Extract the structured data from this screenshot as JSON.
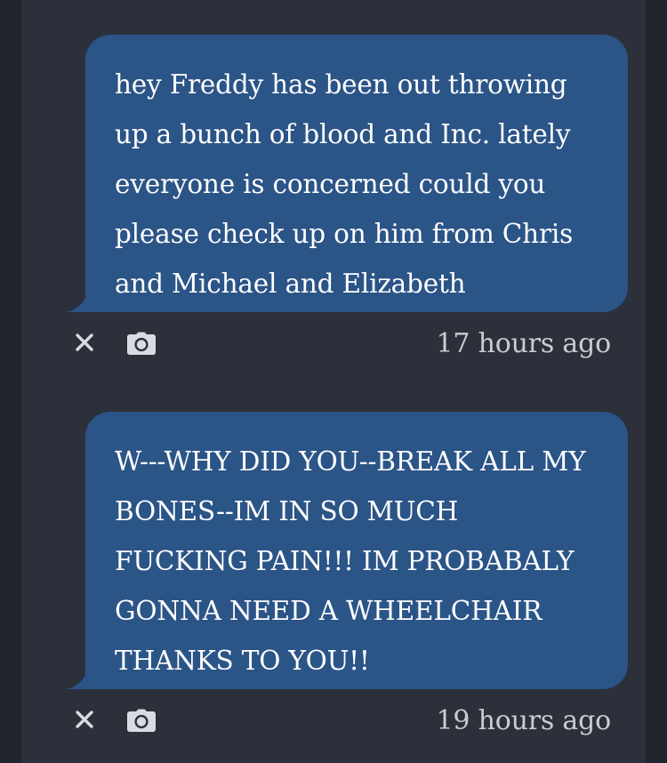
{
  "messages": [
    {
      "text": "hey Freddy has been out throwing up a bunch of blood and Inc. lately everyone is concerned could you please check up on him from Chris and Michael and Elizabeth",
      "timestamp": "17 hours ago",
      "actions": [
        "close-icon",
        "camera-icon"
      ]
    },
    {
      "text": "W---WHY DID YOU--BREAK ALL MY BONES--IM IN SO MUCH FUCKING PAIN!!! IM PROBABALY GONNA NEED A WHEELCHAIR THANKS TO YOU!!",
      "timestamp": "19 hours ago",
      "actions": [
        "close-icon",
        "camera-icon"
      ]
    }
  ],
  "colors": {
    "background": "#21252e",
    "panel": "#2c303b",
    "bubble": "#2b5487",
    "text": "#ffffff",
    "meta": "#c9ccd3"
  }
}
